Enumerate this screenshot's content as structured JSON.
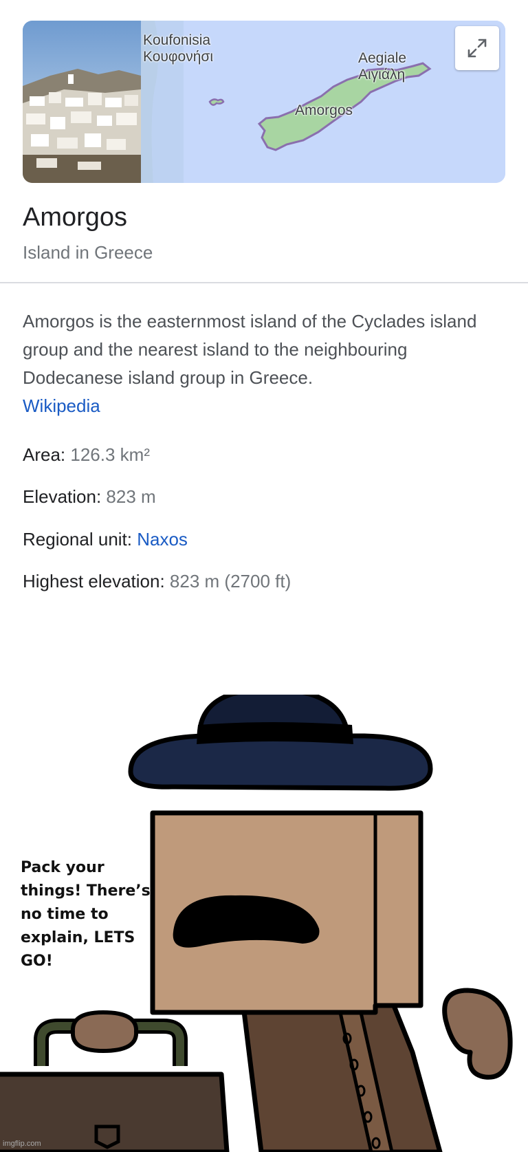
{
  "map_card": {
    "labels": {
      "koufonisia_latin": "Koufonisia",
      "koufonisia_greek": "Κουφονήσι",
      "aegiale_latin": "Aegiale",
      "aegiale_greek": "Αιγιάλη",
      "amorgos": "Amorgos"
    },
    "expand_icon": "expand-arrows-icon"
  },
  "place": {
    "title": "Amorgos",
    "subtitle": "Island in Greece",
    "description": "Amorgos is the easternmost island of the Cyclades island group and the nearest island to the neighbouring Dodecanese island group in Greece.",
    "source_link": "Wikipedia"
  },
  "facts": [
    {
      "label": "Area:",
      "value": "126.3 km²"
    },
    {
      "label": "Elevation:",
      "value": "823 m"
    },
    {
      "label": "Regional unit:",
      "value": "Naxos"
    },
    {
      "label": "Highest elevation:",
      "value": "823 m (2700 ft)"
    }
  ],
  "comic": {
    "speech": "Pack your things! There’s no time to explain, LETS GO!"
  },
  "watermark": "imgflip.com",
  "colors": {
    "link": "#1a5bc4",
    "map_water": "#c6d8fb",
    "island": "#a8d5a2",
    "hat": "#1b2847",
    "box_face": "#bf9a7b",
    "coat": "#5e4433",
    "suitcase": "#4a3a30"
  }
}
